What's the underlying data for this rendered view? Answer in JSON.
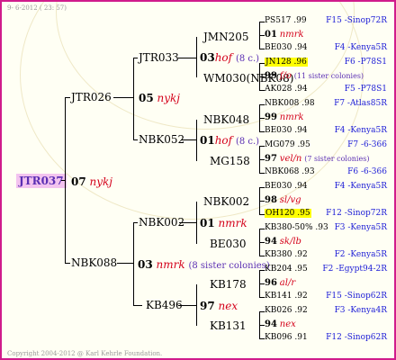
{
  "header": {
    "date": "9- 6-2012 ( 23: 57)"
  },
  "footer": {
    "copyright": "Copyright 2004-2012 @ Karl Kehrle Foundation."
  },
  "root": {
    "name": "JTR037",
    "year": "07",
    "breeder": "nykj"
  },
  "gen1": {
    "sire": {
      "name": "JTR026"
    },
    "dam": {
      "name": "NBK088"
    }
  },
  "gen2": {
    "s": {
      "name": "JTR033",
      "year": "05",
      "breeder": "nykj"
    },
    "sd": {
      "name": "NBK052"
    },
    "d": {
      "name": "NBK002",
      "year": "03",
      "breeder": "nmrk",
      "note": "(8 sister colonies)"
    },
    "dd": {
      "name": "KB496"
    }
  },
  "gen3": {
    "a": {
      "name": "JMN205"
    },
    "a_mid": {
      "year": "03",
      "breeder": "hof",
      "note": "(8 c.)"
    },
    "b": {
      "name": "WM030(NBK08)"
    },
    "c": {
      "name": "NBK048"
    },
    "c_mid": {
      "year": "01",
      "breeder": "hof",
      "note": "(8 c.)"
    },
    "d": {
      "name": "MG158"
    },
    "e": {
      "name": "NBK002"
    },
    "e_mid": {
      "year": "01",
      "breeder": "nmrk"
    },
    "f": {
      "name": "BE030"
    },
    "g": {
      "name": "KB178"
    },
    "g_mid": {
      "year": "97",
      "breeder": "nex"
    },
    "h": {
      "name": "KB131"
    }
  },
  "gen4": [
    {
      "name": "PS517 .99",
      "loc": "F15 -Sinop72R"
    },
    {
      "year": "01",
      "breeder": "nmrk"
    },
    {
      "name": "BE030 .94",
      "loc": "F4 -Kenya5R"
    },
    {
      "name": "JN128 .96",
      "loc": "F6 -P78S1",
      "hl": true
    },
    {
      "year": "99",
      "breeder": "f/o",
      "note": "(11 sister colonies)"
    },
    {
      "name": "AK028 .94",
      "loc": "F5 -P78S1"
    },
    {
      "name": "NBK008 .98",
      "loc": "F7 -Atlas85R"
    },
    {
      "year": "99",
      "breeder": "nmrk"
    },
    {
      "name": "BE030 .94",
      "loc": "F4 -Kenya5R"
    },
    {
      "name": "MG079 .95",
      "loc": "F7 -6-366"
    },
    {
      "year": "97",
      "breeder": "vel/n",
      "note": "(7 sister colonies)"
    },
    {
      "name": "NBK068 .93",
      "loc": "F6 -6-366"
    },
    {
      "name": "BE030 .94",
      "loc": "F4 -Kenya5R"
    },
    {
      "year": "98",
      "breeder": "sl/vg"
    },
    {
      "name": "OH120 .95",
      "loc": "F12 -Sinop72R",
      "hl": true
    },
    {
      "name": "KB380-50% .93",
      "loc": "F3 -Kenya5R"
    },
    {
      "year": "94",
      "breeder": "sk/lb"
    },
    {
      "name": "KB380 .92",
      "loc": "F2 -Kenya5R"
    },
    {
      "name": "KB204 .95",
      "loc": "F2 -Egypt94-2R"
    },
    {
      "year": "96",
      "breeder": "al/r"
    },
    {
      "name": "KB141 .92",
      "loc": "F15 -Sinop62R"
    },
    {
      "name": "KB026 .92",
      "loc": "F3 -Kenya4R"
    },
    {
      "year": "94",
      "breeder": "nex"
    },
    {
      "name": "KB096 .91",
      "loc": "F12 -Sinop62R"
    }
  ]
}
